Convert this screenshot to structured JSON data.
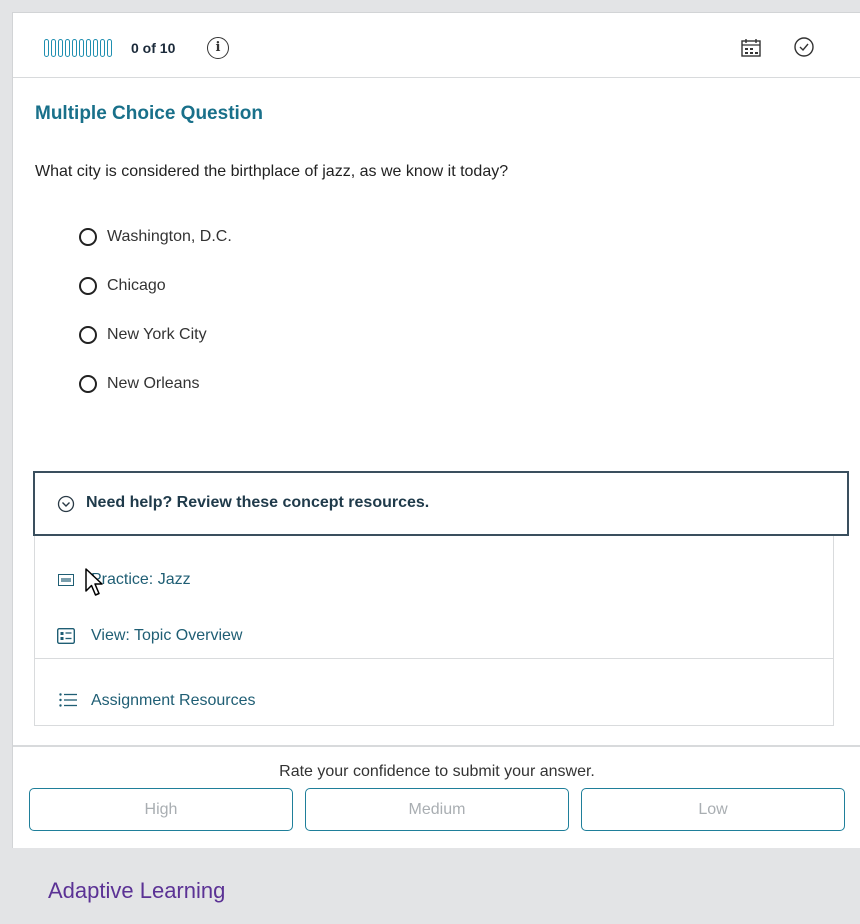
{
  "header": {
    "progress_text": "0 of 10",
    "progress_ticks": 10,
    "progress_completed": 0,
    "info_icon": "info-icon",
    "calendar_icon": "calendar-icon",
    "clock_icon": "clock-icon"
  },
  "question": {
    "type_label": "Multiple Choice Question",
    "text": "What city is considered the birthplace of jazz, as we know it today?",
    "options": [
      "Washington, D.C.",
      "Chicago",
      "New York City",
      "New Orleans"
    ]
  },
  "help": {
    "toggle_label": "Need help? Review these concept resources.",
    "resources": [
      {
        "label": "Practice: Jazz",
        "icon": "practice-icon"
      },
      {
        "label": "View: Topic Overview",
        "icon": "topic-overview-icon"
      }
    ],
    "assignment_label": "Assignment Resources"
  },
  "confidence": {
    "prompt": "Rate your confidence to submit your answer.",
    "buttons": [
      "High",
      "Medium",
      "Low"
    ]
  },
  "caption": "Adaptive Learning",
  "colors": {
    "accent": "#1f7f9a",
    "heading": "#19708a",
    "caption": "#5b3295",
    "background": "#e3e4e6"
  }
}
